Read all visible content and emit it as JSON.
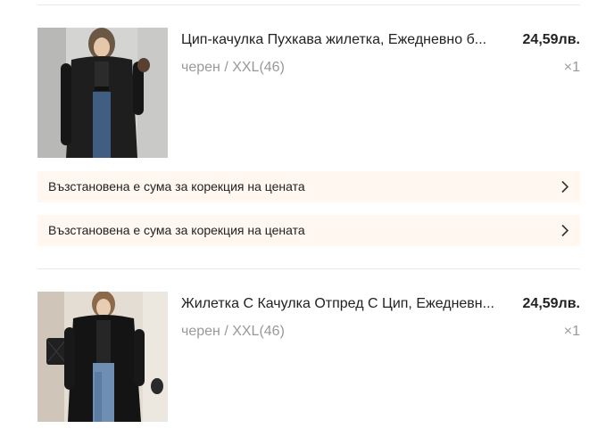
{
  "cart": {
    "items": [
      {
        "title": "Цип-качулка Пухкава жилетка, Ежедневно б...",
        "price": "24,59лв.",
        "variant": "черен / XXL(46)",
        "quantity": "×1"
      },
      {
        "title": "Жилетка С Качулка Отпред С Цип, Ежедневн...",
        "price": "24,59лв.",
        "variant": "черен / XXL(46)",
        "quantity": "×1"
      }
    ],
    "adjustments": [
      {
        "label": "Възстановена е сума за корекция на цената"
      },
      {
        "label": "Възстановена е сума за корекция на цената"
      }
    ]
  },
  "icons": {
    "chevron": "chevron-right-icon"
  },
  "colors": {
    "adjustment_background": "#fff7f0",
    "muted_text": "#999999",
    "divider": "#e8e8e8"
  }
}
